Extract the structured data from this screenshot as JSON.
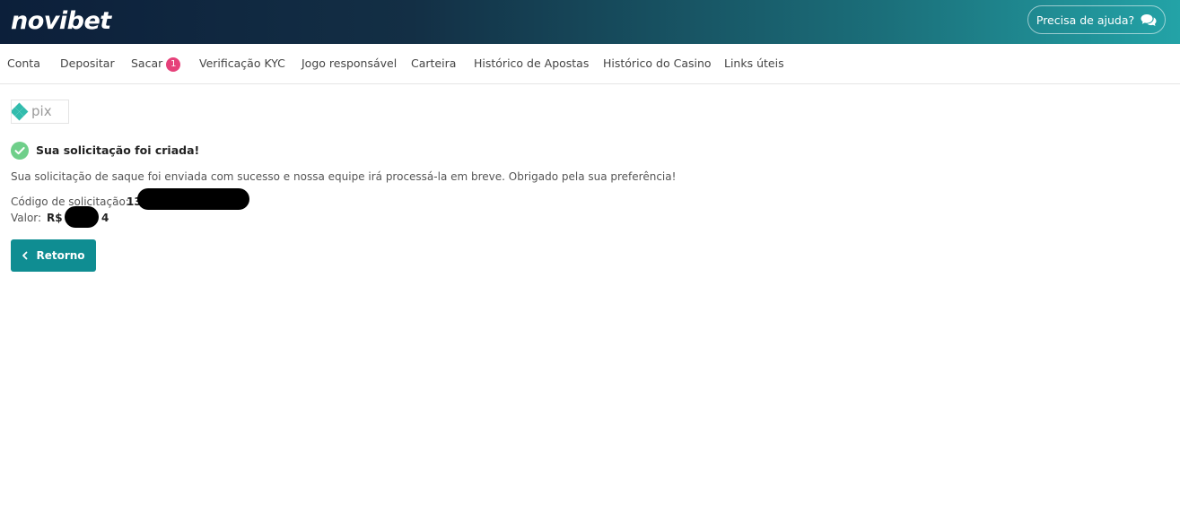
{
  "header": {
    "logo_text": "novibet",
    "help_label": "Precisa de ajuda?",
    "help_icon": "chat-bubbles-icon"
  },
  "nav": {
    "items": [
      {
        "label": "Conta"
      },
      {
        "label": "Depositar"
      },
      {
        "label": "Sacar",
        "badge": "1"
      },
      {
        "label": "Verificação KYC"
      },
      {
        "label": "Jogo responsável"
      },
      {
        "label": "Carteira"
      },
      {
        "label": "Histórico de Apostas"
      },
      {
        "label": "Histórico do Casino"
      },
      {
        "label": "Links úteis"
      }
    ]
  },
  "payment": {
    "method_logo": "pix-logo",
    "logo_text": "pix"
  },
  "result": {
    "status_icon": "check-circle-icon",
    "title": "Sua solicitação foi criada!",
    "message": "Sua solicitação de saque foi enviada com sucesso e nossa equipe irá processá-la em breve. Obrigado pela sua preferência!",
    "code_label": "Código de solicitação:",
    "code_value_visible": "13",
    "amount_label": "Valor:",
    "amount_currency": "R$",
    "amount_tail_visible": "4"
  },
  "actions": {
    "back_label": "Retorno",
    "back_icon": "chevron-left-icon"
  },
  "colors": {
    "header_start": "#0c1f3a",
    "header_end": "#23a3a7",
    "accent": "#0f8d92",
    "badge": "#e6417a",
    "success": "#6fcf8a"
  }
}
